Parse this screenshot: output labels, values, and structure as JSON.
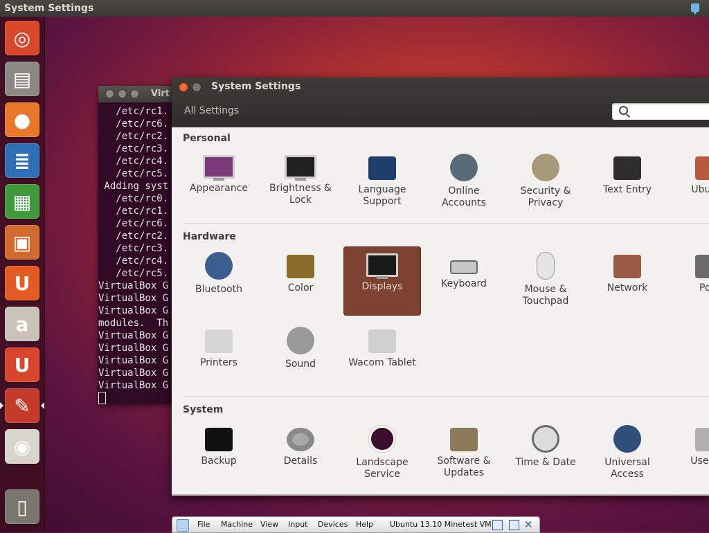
{
  "top_panel": {
    "title": "System Settings"
  },
  "launcher": {
    "items": [
      {
        "name": "dash-home",
        "glyph": "◎",
        "bg": "#d9472b"
      },
      {
        "name": "files",
        "glyph": "▤",
        "bg": "#8c8985"
      },
      {
        "name": "firefox",
        "glyph": "●",
        "bg": "#e8772a"
      },
      {
        "name": "writer",
        "glyph": "≣",
        "bg": "#2f6fb5"
      },
      {
        "name": "calc",
        "glyph": "▦",
        "bg": "#3f9a3b"
      },
      {
        "name": "impress",
        "glyph": "▣",
        "bg": "#d26a2d"
      },
      {
        "name": "ubuntu-software",
        "glyph": "U",
        "bg": "#e35b22"
      },
      {
        "name": "amazon",
        "glyph": "a",
        "bg": "#c8c2b8"
      },
      {
        "name": "ubuntu-one-music",
        "glyph": "U",
        "bg": "#d8452a"
      },
      {
        "name": "system-settings",
        "glyph": "✎",
        "bg": "#c43b2b"
      },
      {
        "name": "dvd",
        "glyph": "◉",
        "bg": "#d9d4cc"
      },
      {
        "name": "trash",
        "glyph": "▯",
        "bg": "#7b756f"
      }
    ]
  },
  "terminal": {
    "title": "Virt",
    "lines": [
      "   /etc/rc1.",
      "   /etc/rc6.",
      "   /etc/rc2.",
      "   /etc/rc3.",
      "   /etc/rc4.",
      "   /etc/rc5.",
      " Adding syst",
      "   /etc/rc0.",
      "   /etc/rc1.",
      "   /etc/rc6.",
      "   /etc/rc2.",
      "   /etc/rc3.",
      "   /etc/rc4.",
      "   /etc/rc5.",
      "VirtualBox G",
      "VirtualBox G",
      "VirtualBox G",
      "modules.  Th",
      "VirtualBox G",
      "VirtualBox G",
      "VirtualBox G",
      "VirtualBox G",
      "VirtualBox G"
    ]
  },
  "settings": {
    "title": "System Settings",
    "all_settings": "All Settings",
    "search_placeholder": "",
    "sections": {
      "personal": "Personal",
      "hardware": "Hardware",
      "system": "System"
    },
    "personal_items": [
      {
        "l1": "Appearance",
        "l2": "",
        "icon": "appearance-icon",
        "color": "#7a3a7a"
      },
      {
        "l1": "Brightness &",
        "l2": "Lock",
        "icon": "lock-icon",
        "color": "#222222"
      },
      {
        "l1": "Language",
        "l2": "Support",
        "icon": "language-icon",
        "color": "#1f3d6b"
      },
      {
        "l1": "Online",
        "l2": "Accounts",
        "icon": "online-accounts-icon",
        "color": "#5a6b78"
      },
      {
        "l1": "Security &",
        "l2": "Privacy",
        "icon": "security-icon",
        "color": "#a69a7a"
      },
      {
        "l1": "Text Entry",
        "l2": "",
        "icon": "text-entry-icon",
        "color": "#2e2e2e"
      },
      {
        "l1": "Ubuntu",
        "l2": "",
        "icon": "ubuntu-one-icon",
        "color": "#b95a3c"
      }
    ],
    "hardware_items": [
      {
        "l1": "Bluetooth",
        "l2": "",
        "icon": "bluetooth-icon",
        "color": "#3a5f8f"
      },
      {
        "l1": "Color",
        "l2": "",
        "icon": "color-icon",
        "color": "#8a6a2a"
      },
      {
        "l1": "Displays",
        "l2": "",
        "icon": "displays-icon",
        "color": "#1a1a1a"
      },
      {
        "l1": "Keyboard",
        "l2": "",
        "icon": "keyboard-icon",
        "color": "#c8c8c8"
      },
      {
        "l1": "Mouse &",
        "l2": "Touchpad",
        "icon": "mouse-icon",
        "color": "#e4e4e4"
      },
      {
        "l1": "Network",
        "l2": "",
        "icon": "network-icon",
        "color": "#9a5a45"
      },
      {
        "l1": "Pow",
        "l2": "",
        "icon": "power-icon",
        "color": "#6a6a6a"
      },
      {
        "l1": "Printers",
        "l2": "",
        "icon": "printer-icon",
        "color": "#d6d6d6"
      },
      {
        "l1": "Sound",
        "l2": "",
        "icon": "sound-icon",
        "color": "#9a9a9a"
      },
      {
        "l1": "Wacom Tablet",
        "l2": "",
        "icon": "wacom-icon",
        "color": "#d0d0d0"
      }
    ],
    "system_items": [
      {
        "l1": "Backup",
        "l2": "",
        "icon": "backup-icon",
        "color": "#111111"
      },
      {
        "l1": "Details",
        "l2": "",
        "icon": "gear-icon",
        "color": "#a8a8a8"
      },
      {
        "l1": "Landscape",
        "l2": "Service",
        "icon": "landscape-icon",
        "color": "#3a0c2e"
      },
      {
        "l1": "Software &",
        "l2": "Updates",
        "icon": "software-updates-icon",
        "color": "#8c7a5a"
      },
      {
        "l1": "Time & Date",
        "l2": "",
        "icon": "clock-icon",
        "color": "#dcdcdc"
      },
      {
        "l1": "Universal",
        "l2": "Access",
        "icon": "accessibility-icon",
        "color": "#2f4f7a"
      },
      {
        "l1": "User Ac",
        "l2": "",
        "icon": "user-accounts-icon",
        "color": "#b0b0b0"
      }
    ]
  },
  "vbox_bar": {
    "menus": [
      "File",
      "Machine",
      "View",
      "Input",
      "Devices",
      "Help"
    ],
    "vm_name": "Ubuntu 13.10 Minetest VM"
  }
}
